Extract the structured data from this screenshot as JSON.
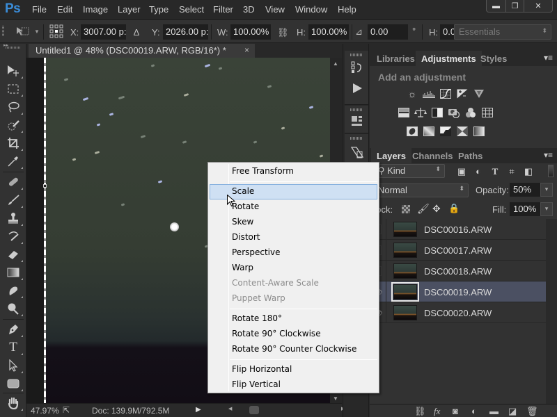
{
  "app": {
    "logo": "Ps",
    "menu": [
      "File",
      "Edit",
      "Image",
      "Layer",
      "Type",
      "Select",
      "Filter",
      "3D",
      "View",
      "Window",
      "Help"
    ],
    "window_controls": {
      "minimize": "▬",
      "restore": "❐",
      "close": "✕"
    }
  },
  "options_bar": {
    "x_label": "X:",
    "x_value": "3007.00 p:",
    "delta_icon": "∆",
    "y_label": "Y:",
    "y_value": "2026.00 p:",
    "w_label": "W:",
    "w_value": "100.00%",
    "h_label": "H:",
    "h_value": "100.00%",
    "angle_value": "0.00",
    "degree": "°",
    "h2_label": "H:",
    "h2_value": "0.0",
    "workspace": "Essentials"
  },
  "document": {
    "tab_title": "Untitled1 @ 48% (DSC00019.ARW, RGB/16*) *",
    "close": "×"
  },
  "status": {
    "zoom": "47.97%",
    "doc": "Doc: 139.9M/792.5M"
  },
  "tools": [
    "move",
    "rectangular-marquee",
    "lasso",
    "quick-selection",
    "crop",
    "eyedropper",
    "spot-healing-brush",
    "brush",
    "clone-stamp",
    "history-brush",
    "eraser",
    "gradient",
    "smudge",
    "dodge",
    "pen",
    "type",
    "path-selection",
    "rectangle",
    "hand"
  ],
  "adjustments_panel": {
    "tabs": [
      "Libraries",
      "Adjustments",
      "Styles"
    ],
    "active_tab": "Adjustments",
    "title": "Add an adjustment",
    "icons_row1": [
      "brightness-contrast",
      "levels",
      "curves",
      "exposure",
      "vibrance"
    ],
    "icons_row2": [
      "hue-saturation",
      "color-balance",
      "black-white",
      "photo-filter",
      "channel-mixer",
      "color-lookup"
    ],
    "icons_row3": [
      "invert",
      "posterize",
      "threshold",
      "selective-color",
      "gradient-map"
    ]
  },
  "layers_panel": {
    "tabs": [
      "Layers",
      "Channels",
      "Paths"
    ],
    "active_tab": "Layers",
    "filter_kind": "Kind",
    "blend_mode": "Normal",
    "opacity_label": "Opacity:",
    "opacity_value": "50%",
    "lock_label": "Lock:",
    "fill_label": "Fill:",
    "fill_value": "100%",
    "layers": [
      {
        "name": "DSC00016.ARW",
        "visible": false,
        "selected": false
      },
      {
        "name": "DSC00017.ARW",
        "visible": false,
        "selected": false
      },
      {
        "name": "DSC00018.ARW",
        "visible": false,
        "selected": false
      },
      {
        "name": "DSC00019.ARW",
        "visible": true,
        "selected": true
      },
      {
        "name": "DSC00020.ARW",
        "visible": true,
        "selected": false
      }
    ]
  },
  "context_menu": {
    "items": [
      {
        "label": "Free Transform",
        "state": "normal"
      },
      {
        "label": "Scale",
        "state": "hover"
      },
      {
        "label": "Rotate",
        "state": "normal"
      },
      {
        "label": "Skew",
        "state": "normal"
      },
      {
        "label": "Distort",
        "state": "normal"
      },
      {
        "label": "Perspective",
        "state": "normal"
      },
      {
        "label": "Warp",
        "state": "normal"
      },
      {
        "label": "Content-Aware Scale",
        "state": "disabled"
      },
      {
        "label": "Puppet Warp",
        "state": "disabled"
      },
      {
        "label": "Rotate 180°",
        "state": "normal"
      },
      {
        "label": "Rotate 90° Clockwise",
        "state": "normal"
      },
      {
        "label": "Rotate 90° Counter Clockwise",
        "state": "normal"
      },
      {
        "label": "Flip Horizontal",
        "state": "normal"
      },
      {
        "label": "Flip Vertical",
        "state": "normal"
      }
    ]
  }
}
